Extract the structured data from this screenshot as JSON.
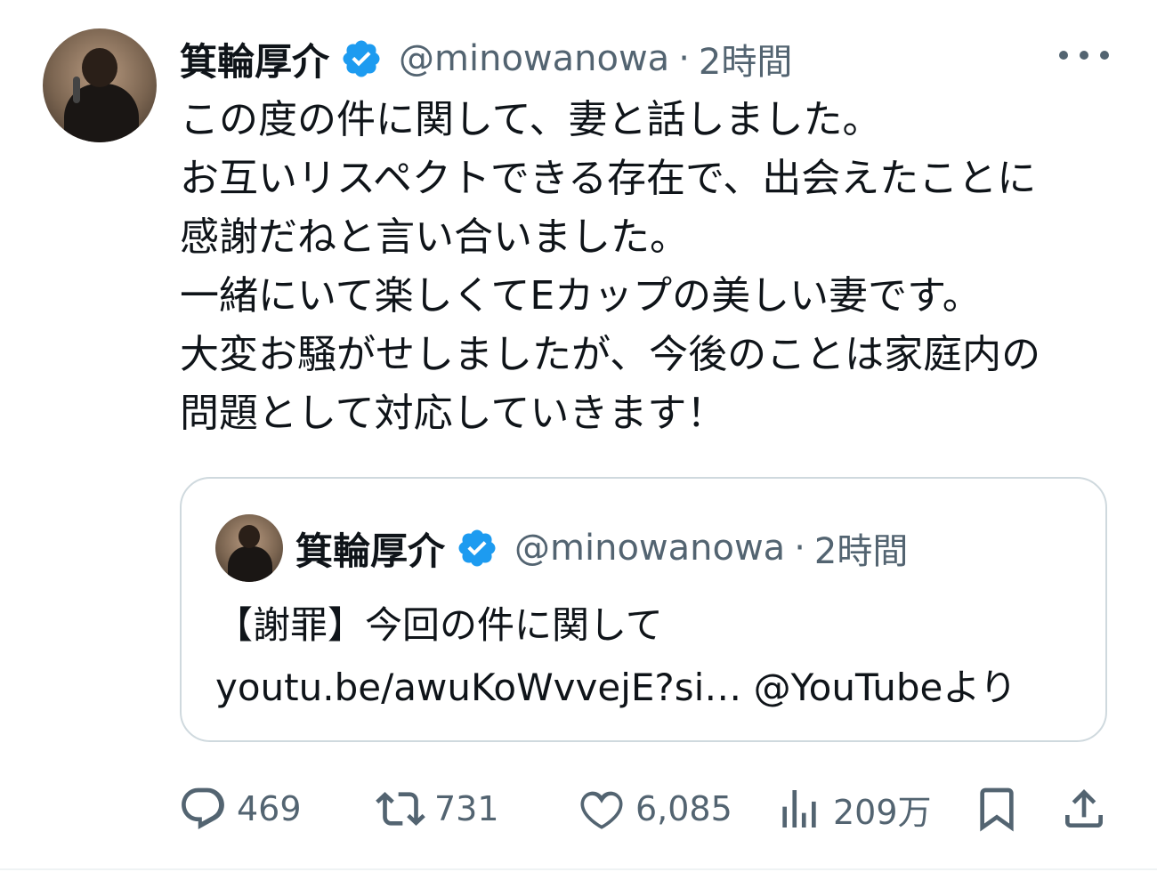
{
  "tweet": {
    "author": {
      "display_name": "箕輪厚介",
      "handle": "@minowanowa",
      "verified": true
    },
    "separator": "·",
    "time": "2時間",
    "lines": [
      "この度の件に関して、妻と話しました。",
      "お互いリスペクトできる存在で、出会えたことに",
      "感謝だねと言い合いました。",
      "一緒にいて楽しくてEカップの美しい妻です。",
      "大変お騒がせしましたが、今後のことは家庭内の",
      "問題として対応していきます！"
    ]
  },
  "quote": {
    "author": {
      "display_name": "箕輪厚介",
      "handle": "@minowanowa",
      "verified": true
    },
    "separator": "·",
    "time": "2時間",
    "lines": [
      "【謝罪】今回の件に関して",
      "youtu.be/awuKoWvvejE?si… @YouTubeより"
    ]
  },
  "actions": {
    "replies": {
      "icon": "reply-icon",
      "count": "469"
    },
    "reposts": {
      "icon": "repost-icon",
      "count": "731"
    },
    "likes": {
      "icon": "heart-icon",
      "count": "6,085"
    },
    "views": {
      "icon": "analytics-icon",
      "count": "209万"
    },
    "bookmark": {
      "icon": "bookmark-icon"
    },
    "share": {
      "icon": "share-icon"
    }
  },
  "colors": {
    "text": "#0f1419",
    "secondary": "#536471",
    "verified": "#1d9bf0",
    "border": "#cfd9de"
  }
}
